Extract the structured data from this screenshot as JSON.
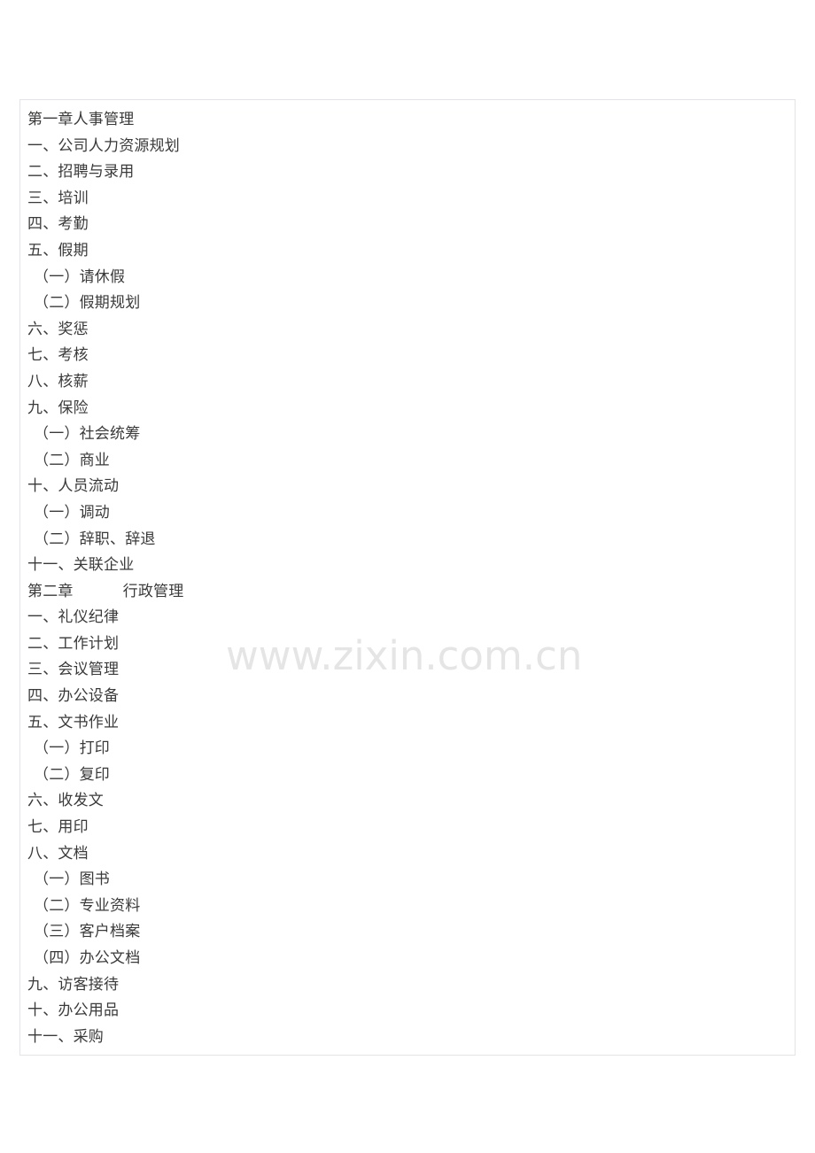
{
  "document": {
    "watermark": "www.zixin.com.cn",
    "outline": [
      {
        "text": "第一章人事管理",
        "level": "chapter"
      },
      {
        "text": "一、公司人力资源规划",
        "level": "lvl1"
      },
      {
        "text": "二、招聘与录用",
        "level": "lvl1"
      },
      {
        "text": "三、培训",
        "level": "lvl1"
      },
      {
        "text": "四、考勤",
        "level": "lvl1"
      },
      {
        "text": "五、假期",
        "level": "lvl1"
      },
      {
        "text": "（一）请休假",
        "level": "lvl2"
      },
      {
        "text": "（二）假期规划",
        "level": "lvl2"
      },
      {
        "text": "六、奖惩",
        "level": "lvl1"
      },
      {
        "text": "七、考核",
        "level": "lvl1"
      },
      {
        "text": "八、核薪",
        "level": "lvl1"
      },
      {
        "text": "九、保险",
        "level": "lvl1"
      },
      {
        "text": "（一）社会统筹",
        "level": "lvl2"
      },
      {
        "text": "（二）商业",
        "level": "lvl2"
      },
      {
        "text": "十、人员流动",
        "level": "lvl1"
      },
      {
        "text": "（一）调动",
        "level": "lvl2"
      },
      {
        "text": "（二）辞职、辞退",
        "level": "lvl2"
      },
      {
        "text": "十一、关联企业",
        "level": "lvl1"
      },
      {
        "text": "第二章          行政管理",
        "level": "chapter"
      },
      {
        "text": "一、礼仪纪律",
        "level": "lvl1"
      },
      {
        "text": "二、工作计划",
        "level": "lvl1"
      },
      {
        "text": "三、会议管理",
        "level": "lvl1"
      },
      {
        "text": "四、办公设备",
        "level": "lvl1"
      },
      {
        "text": "五、文书作业",
        "level": "lvl1"
      },
      {
        "text": "（一）打印",
        "level": "lvl2"
      },
      {
        "text": "（二）复印",
        "level": "lvl2"
      },
      {
        "text": "六、收发文",
        "level": "lvl1"
      },
      {
        "text": "七、用印",
        "level": "lvl1"
      },
      {
        "text": "八、文档",
        "level": "lvl1"
      },
      {
        "text": "（一）图书",
        "level": "lvl2"
      },
      {
        "text": "（二）专业资料",
        "level": "lvl2"
      },
      {
        "text": "（三）客户档案",
        "level": "lvl2"
      },
      {
        "text": "（四）办公文档",
        "level": "lvl2"
      },
      {
        "text": "九、访客接待",
        "level": "lvl1"
      },
      {
        "text": "十、办公用品",
        "level": "lvl1"
      },
      {
        "text": "十一、采购",
        "level": "lvl1"
      }
    ]
  }
}
